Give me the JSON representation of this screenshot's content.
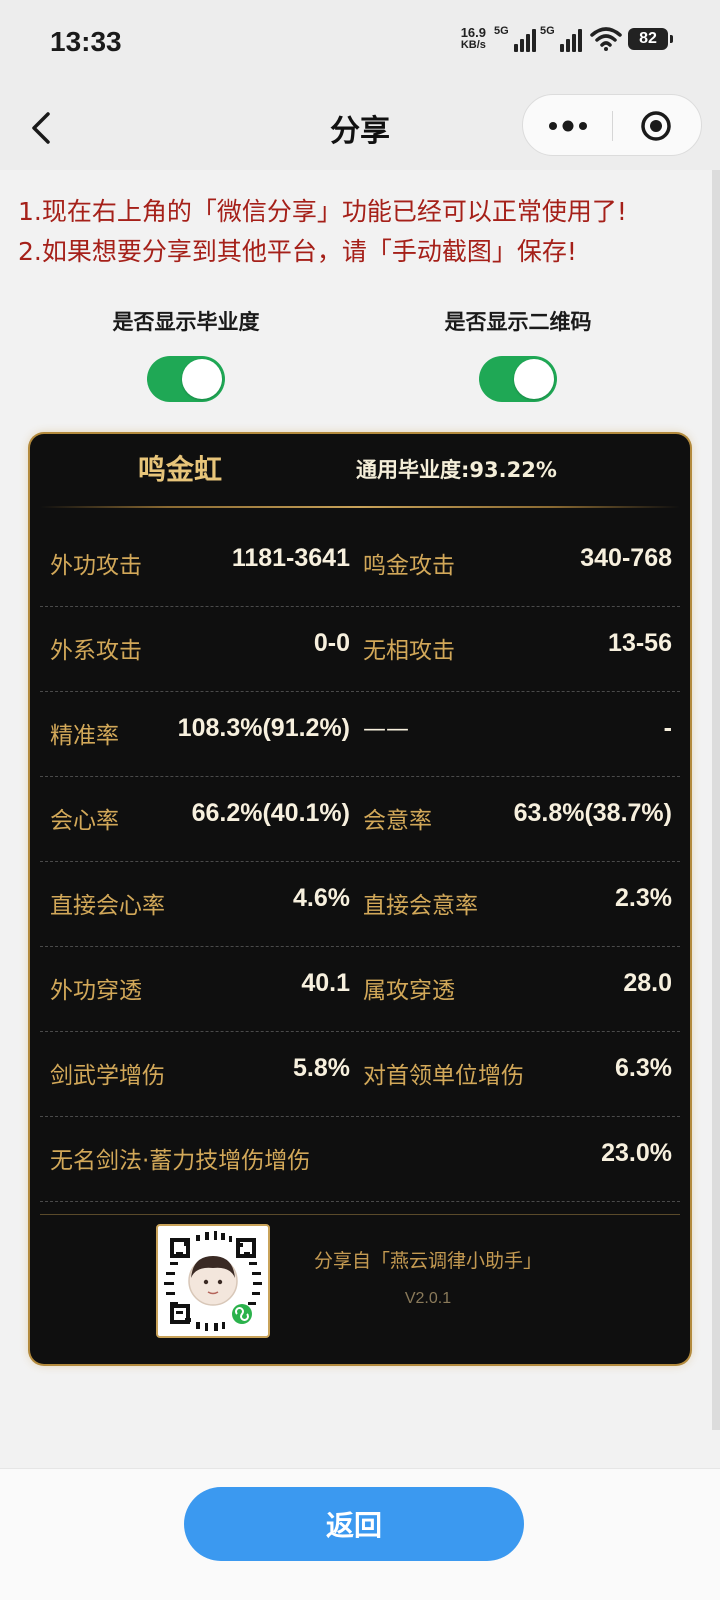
{
  "status_bar": {
    "time": "13:33",
    "net_speed_value": "16.9",
    "net_speed_unit": "KB/s",
    "signal_1": "5G",
    "signal_2": "5G",
    "battery": "82"
  },
  "nav": {
    "title": "分享",
    "back_icon": "chevron-left-icon",
    "more_icon": "more-dots-icon",
    "record_icon": "target-circle-icon"
  },
  "notice": {
    "line1": "1.现在右上角的「微信分享」功能已经可以正常使用了!",
    "line2": "2.如果想要分享到其他平台，请「手动截图」保存!",
    "color": "#a52019"
  },
  "toggles": {
    "show_grad": {
      "label": "是否显示毕业度",
      "on": true
    },
    "show_qr": {
      "label": "是否显示二维码",
      "on": true
    },
    "on_color": "#1fa855"
  },
  "card": {
    "name": "鸣金虹",
    "grad_score": "通用毕业度:93.22%",
    "rows": [
      {
        "left_label": "外功攻击",
        "left_value": "1181-3641",
        "right_label": "鸣金攻击",
        "right_value": "340-768"
      },
      {
        "left_label": "外系攻击",
        "left_value": "0-0",
        "right_label": "无相攻击",
        "right_value": "13-56"
      },
      {
        "left_label": "精准率",
        "left_value": "108.3%(91.2%)",
        "right_label": "——",
        "right_value": "-"
      },
      {
        "left_label": "会心率",
        "left_value": "66.2%(40.1%)",
        "right_label": "会意率",
        "right_value": "63.8%(38.7%)"
      },
      {
        "left_label": "直接会心率",
        "left_value": "4.6%",
        "right_label": "直接会意率",
        "right_value": "2.3%"
      },
      {
        "left_label": "外功穿透",
        "left_value": "40.1",
        "right_label": "属攻穿透",
        "right_value": "28.0"
      },
      {
        "left_label": "剑武学增伤",
        "left_value": "5.8%",
        "right_label": "对首领单位增伤",
        "right_value": "6.3%"
      },
      {
        "left_label": "无名剑法·蓄力技增伤增伤",
        "left_value": "",
        "right_label": "",
        "right_value": "23.0%"
      }
    ],
    "share_from": "分享自「燕云调律小助手」",
    "version": "V2.0.1",
    "qr_icon": "mini-program-qr-code-icon",
    "label_color": "#d2a859",
    "value_color": "#f7f0de",
    "border_color": "#b38a3d"
  },
  "bottom": {
    "back_button": "返回",
    "button_color": "#3b99f0"
  }
}
